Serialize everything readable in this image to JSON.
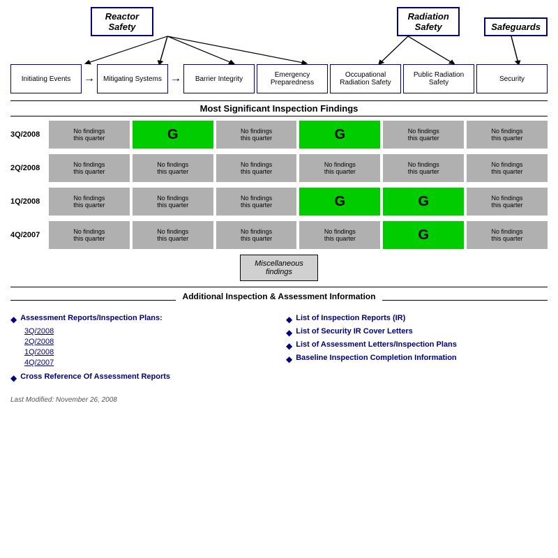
{
  "header": {
    "main_categories": [
      {
        "id": "reactor-safety",
        "label": "Reactor\nSafety"
      },
      {
        "id": "radiation-safety",
        "label": "Radiation\nSafety"
      },
      {
        "id": "safeguards",
        "label": "Safeguards"
      }
    ],
    "subcategories": [
      {
        "id": "initiating-events",
        "label": "Initiating Events"
      },
      {
        "id": "mitigating-systems",
        "label": "Mitigating Systems"
      },
      {
        "id": "barrier-integrity",
        "label": "Barrier Integrity"
      },
      {
        "id": "emergency-preparedness",
        "label": "Emergency Preparedness"
      },
      {
        "id": "occupational-radiation",
        "label": "Occupational Radiation Safety"
      },
      {
        "id": "public-radiation",
        "label": "Public Radiation Safety"
      },
      {
        "id": "security",
        "label": "Security"
      }
    ]
  },
  "most_significant_title": "Most Significant Inspection Findings",
  "quarters": [
    {
      "label": "3Q/2008",
      "cells": [
        {
          "type": "gray",
          "text": "No findings this quarter"
        },
        {
          "type": "green",
          "text": "G"
        },
        {
          "type": "gray",
          "text": "No findings this quarter"
        },
        {
          "type": "green",
          "text": "G"
        },
        {
          "type": "gray",
          "text": "No findings this quarter"
        },
        {
          "type": "gray",
          "text": "No findings this quarter"
        }
      ]
    },
    {
      "label": "2Q/2008",
      "cells": [
        {
          "type": "gray",
          "text": "No findings this quarter"
        },
        {
          "type": "gray",
          "text": "No findings this quarter"
        },
        {
          "type": "gray",
          "text": "No findings this quarter"
        },
        {
          "type": "gray",
          "text": "No findings this quarter"
        },
        {
          "type": "gray",
          "text": "No findings this quarter"
        },
        {
          "type": "gray",
          "text": "No findings this quarter"
        }
      ]
    },
    {
      "label": "1Q/2008",
      "cells": [
        {
          "type": "gray",
          "text": "No findings this quarter"
        },
        {
          "type": "gray",
          "text": "No findings this quarter"
        },
        {
          "type": "gray",
          "text": "No findings this quarter"
        },
        {
          "type": "green",
          "text": "G"
        },
        {
          "type": "green",
          "text": "G"
        },
        {
          "type": "gray",
          "text": "No findings this quarter"
        }
      ]
    },
    {
      "label": "4Q/2007",
      "cells": [
        {
          "type": "gray",
          "text": "No findings this quarter"
        },
        {
          "type": "gray",
          "text": "No findings this quarter"
        },
        {
          "type": "gray",
          "text": "No findings this quarter"
        },
        {
          "type": "gray",
          "text": "No findings this quarter"
        },
        {
          "type": "green",
          "text": "G"
        },
        {
          "type": "gray",
          "text": "No findings this quarter"
        }
      ]
    }
  ],
  "misc_box": {
    "label": "Miscellaneous\nfindings"
  },
  "additional_section": {
    "title": "Additional Inspection & Assessment Information",
    "left_col": {
      "heading": "Assessment Reports/Inspection Plans:",
      "links": [
        {
          "label": "3Q/2008"
        },
        {
          "label": "2Q/2008"
        },
        {
          "label": "1Q/2008"
        },
        {
          "label": "4Q/2007"
        }
      ],
      "bottom_link": "Cross Reference Of Assessment Reports"
    },
    "right_col": {
      "links": [
        {
          "label": "List of Inspection Reports (IR)"
        },
        {
          "label": "List of Security IR Cover Letters"
        },
        {
          "label": "List of Assessment Letters/Inspection Plans"
        },
        {
          "label": "Baseline Inspection Completion Information"
        }
      ]
    }
  },
  "last_modified": "Last Modified:  November 26, 2008"
}
